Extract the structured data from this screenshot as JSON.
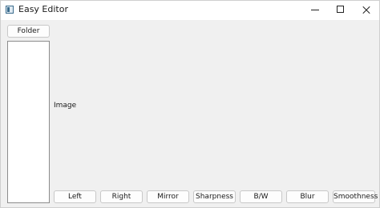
{
  "window": {
    "title": "Easy Editor"
  },
  "sidebar": {
    "folder_button": "Folder"
  },
  "main": {
    "image_placeholder": "Image"
  },
  "toolbar": {
    "buttons": [
      "Left",
      "Right",
      "Mirror",
      "Sharpness",
      "B/W",
      "Blur",
      "Smoothness"
    ]
  }
}
